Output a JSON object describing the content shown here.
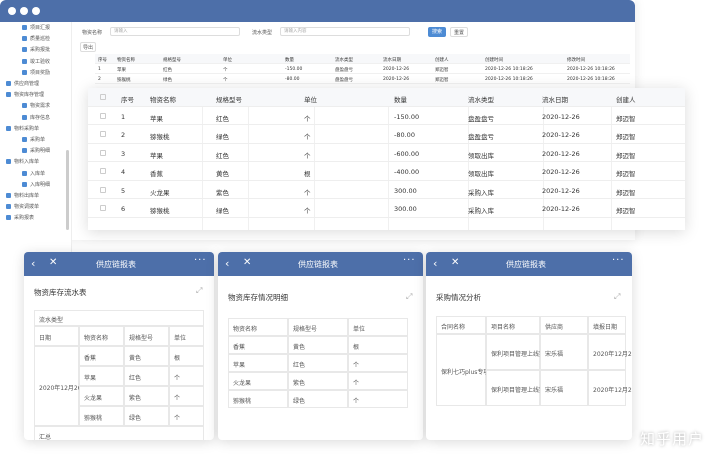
{
  "sidebar": [
    "项目汇报",
    "质量巡检",
    "采购报批",
    "竣工验收",
    "项目奖励",
    "供应商管理",
    "物资库存管理",
    "物资需求",
    "库存信息",
    "物料采购单",
    "采购单",
    "采购明细",
    "物料入库单",
    "入库单",
    "入库明细",
    "物料出库单",
    "物资调拨单",
    "采购报表"
  ],
  "filter": {
    "type_label": "物资名称",
    "type_ph": "请输入",
    "flow_label": "流水类型",
    "flow_ph": "请输入内容",
    "search": "搜索",
    "reset": "重置",
    "export": "导出"
  },
  "small_table": {
    "headers": [
      "序号",
      "物资名称",
      "规格型号",
      "单位",
      "数量",
      "流水类型",
      "流水日期",
      "创建人",
      "创建时间",
      "修改时间"
    ],
    "rows": [
      [
        "1",
        "苹果",
        "红色",
        "个",
        "-150.00",
        "盘盈盘亏",
        "2020-12-26",
        "郑迈智",
        "2020-12-26 10:18:26",
        "2020-12-26 10:18:26"
      ],
      [
        "2",
        "猕猴桃",
        "绿色",
        "个",
        "-80.00",
        "盘盈盘亏",
        "2020-12-26",
        "郑迈智",
        "2020-12-26 10:18:26",
        "2020-12-26 10:18:26"
      ]
    ]
  },
  "big_table": {
    "headers": [
      "序号",
      "物资名称",
      "规格型号",
      "单位",
      "数量",
      "流水类型",
      "流水日期",
      "创建人"
    ],
    "rows": [
      [
        "1",
        "苹果",
        "红色",
        "个",
        "-150.00",
        "盘盈盘亏",
        "2020-12-26",
        "郑迈智"
      ],
      [
        "2",
        "猕猴桃",
        "绿色",
        "个",
        "-80.00",
        "盘盈盘亏",
        "2020-12-26",
        "郑迈智"
      ],
      [
        "3",
        "苹果",
        "红色",
        "个",
        "-600.00",
        "领取出库",
        "2020-12-26",
        "郑迈智"
      ],
      [
        "4",
        "香蕉",
        "黄色",
        "根",
        "-400.00",
        "领取出库",
        "2020-12-26",
        "郑迈智"
      ],
      [
        "5",
        "火龙果",
        "紫色",
        "个",
        "300.00",
        "采购入库",
        "2020-12-26",
        "郑迈智"
      ],
      [
        "6",
        "猕猴桃",
        "绿色",
        "个",
        "300.00",
        "采购入库",
        "2020-12-26",
        "郑迈智"
      ]
    ]
  },
  "card1": {
    "header": "供应链报表",
    "title": "物资库存流水表",
    "group": "流水类型",
    "headers": [
      "日期",
      "物资名称",
      "规格型号",
      "单位"
    ],
    "date": "2020年12月26日",
    "rows": [
      [
        "香蕉",
        "黄色",
        "根"
      ],
      [
        "苹果",
        "红色",
        "个"
      ],
      [
        "火龙果",
        "紫色",
        "个"
      ],
      [
        "猕猴桃",
        "绿色",
        "个"
      ]
    ],
    "footer": "汇总"
  },
  "card2": {
    "header": "供应链报表",
    "title": "物资库存情况明细",
    "headers": [
      "物资名称",
      "规格型号",
      "单位"
    ],
    "rows": [
      [
        "香蕉",
        "黄色",
        "根"
      ],
      [
        "苹果",
        "红色",
        "个"
      ],
      [
        "火龙果",
        "紫色",
        "个"
      ],
      [
        "猕猴桃",
        "绿色",
        "个"
      ]
    ]
  },
  "card3": {
    "header": "供应链报表",
    "title": "采购情况分析",
    "headers": [
      "合同名称",
      "项目名称",
      "供应商",
      "填报日期"
    ],
    "contract": "保利七巧plus专项合同",
    "rows": [
      [
        "保利项目管理上线实施项目",
        "宋乐福",
        "2020年12月26日"
      ],
      [
        "保利项目管理上线实施项目",
        "宋乐福",
        "2020年12月26日"
      ]
    ]
  },
  "watermark": "知乎用户"
}
